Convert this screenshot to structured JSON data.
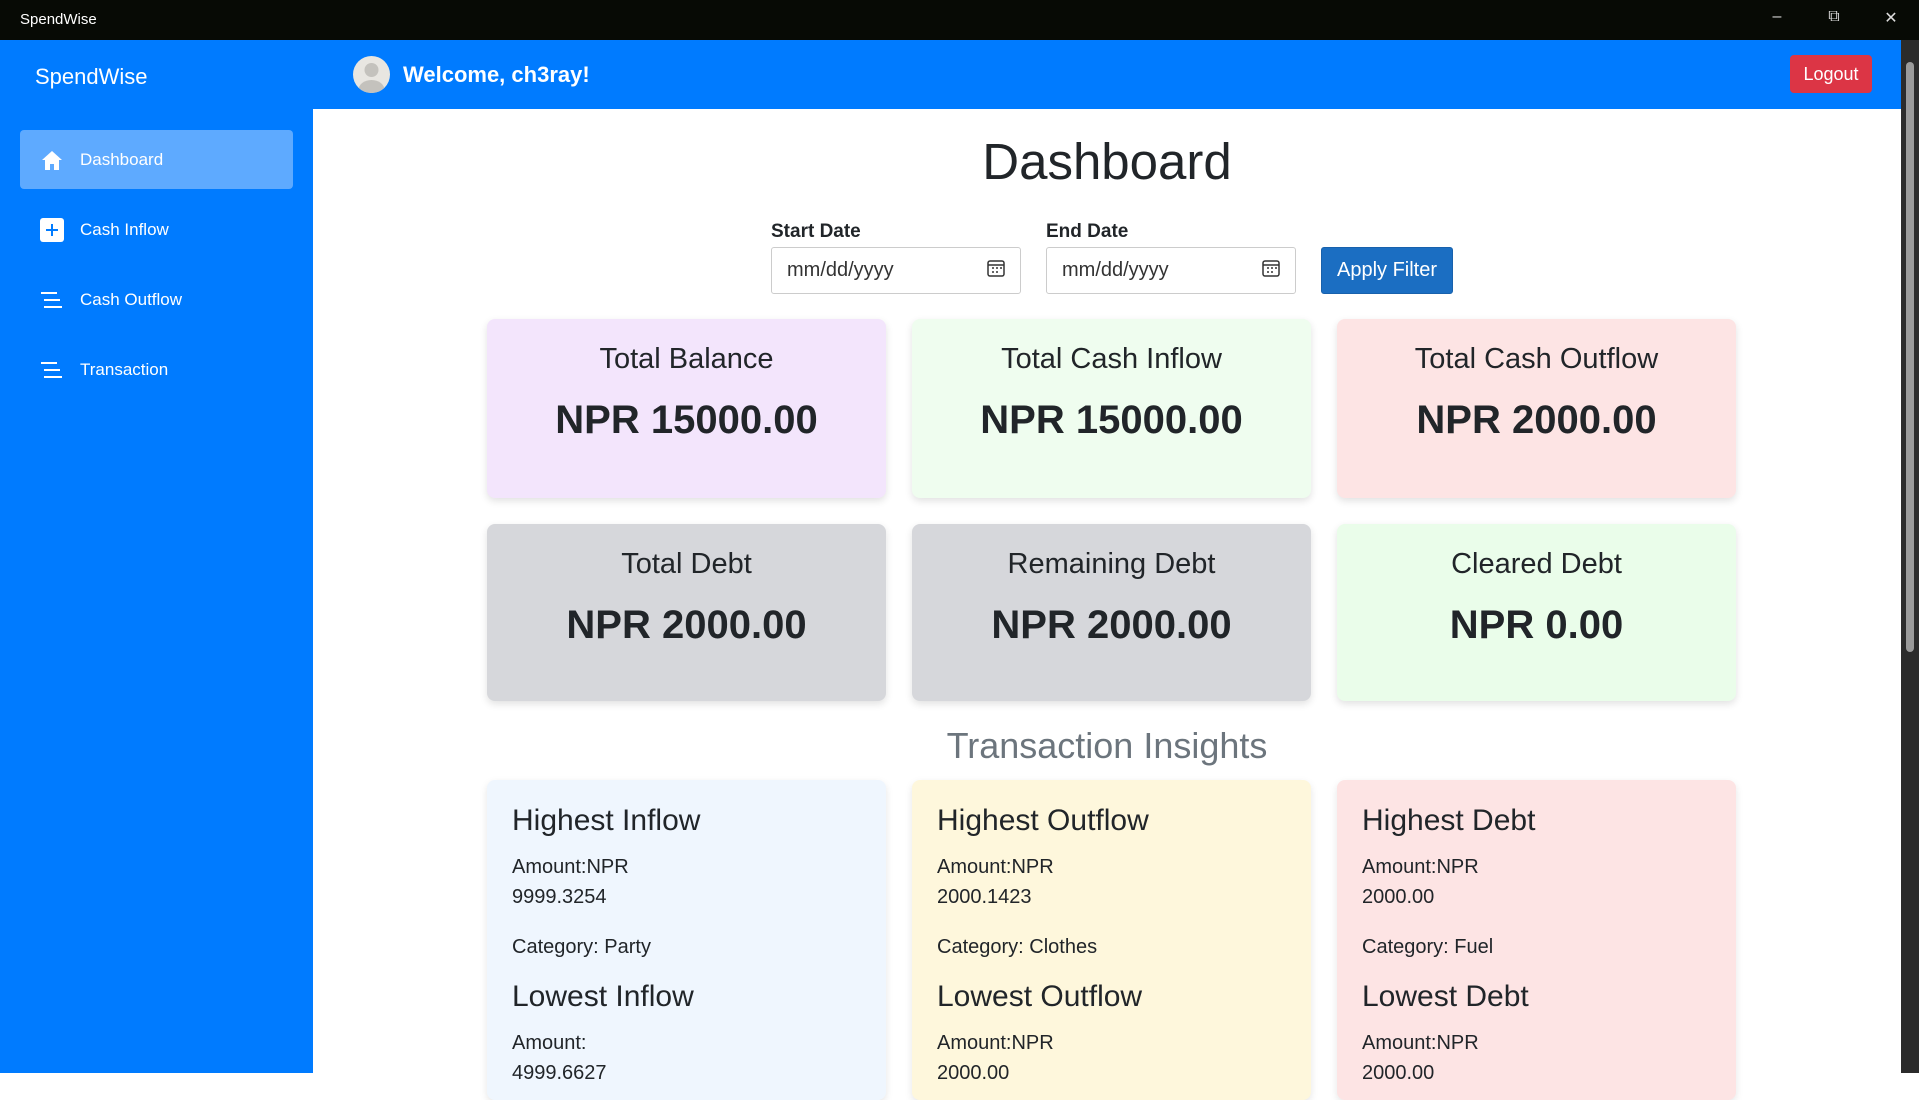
{
  "window": {
    "title": "SpendWise"
  },
  "sidebar": {
    "logo": "SpendWise",
    "items": [
      {
        "label": "Dashboard",
        "icon": "home-icon"
      },
      {
        "label": "Cash Inflow",
        "icon": "plus-square-icon"
      },
      {
        "label": "Cash Outflow",
        "icon": "list-icon"
      },
      {
        "label": "Transaction",
        "icon": "list-icon"
      }
    ]
  },
  "header": {
    "welcome": "Welcome, ch3ray!",
    "logout": "Logout"
  },
  "main": {
    "title": "Dashboard",
    "filter": {
      "start_label": "Start Date",
      "end_label": "End Date",
      "start_placeholder": "mm/dd/yyyy",
      "end_placeholder": "mm/dd/yyyy",
      "apply": "Apply Filter"
    },
    "cards": [
      {
        "title": "Total Balance",
        "value": "NPR 15000.00",
        "color": "#f3e5fc"
      },
      {
        "title": "Total Cash Inflow",
        "value": "NPR 15000.00",
        "color": "#effdef"
      },
      {
        "title": "Total Cash Outflow",
        "value": "NPR 2000.00",
        "color": "#fde4e4"
      },
      {
        "title": "Total Debt",
        "value": "NPR 2000.00",
        "color": "#d6d7db"
      },
      {
        "title": "Remaining Debt",
        "value": "NPR 2000.00",
        "color": "#d6d7db"
      },
      {
        "title": "Cleared Debt",
        "value": "NPR 0.00",
        "color": "#eafdea"
      }
    ],
    "insights_title": "Transaction Insights",
    "insights": [
      {
        "high_title": "Highest Inflow",
        "high_amount_label": "Amount:NPR",
        "high_amount": "9999.3254",
        "high_category": "Category: Party",
        "low_title": "Lowest Inflow",
        "low_amount_label": "Amount:",
        "low_amount": "4999.6627",
        "color": "#eff6fe"
      },
      {
        "high_title": "Highest Outflow",
        "high_amount_label": "Amount:NPR",
        "high_amount": "2000.1423",
        "high_category": "Category: Clothes",
        "low_title": "Lowest Outflow",
        "low_amount_label": "Amount:NPR",
        "low_amount": "2000.00",
        "color": "#fef7dc"
      },
      {
        "high_title": "Highest Debt",
        "high_amount_label": "Amount:NPR",
        "high_amount": "2000.00",
        "high_category": "Category: Fuel",
        "low_title": "Lowest Debt",
        "low_amount_label": "Amount:NPR",
        "low_amount": "2000.00",
        "color": "#fde4e4"
      }
    ]
  }
}
